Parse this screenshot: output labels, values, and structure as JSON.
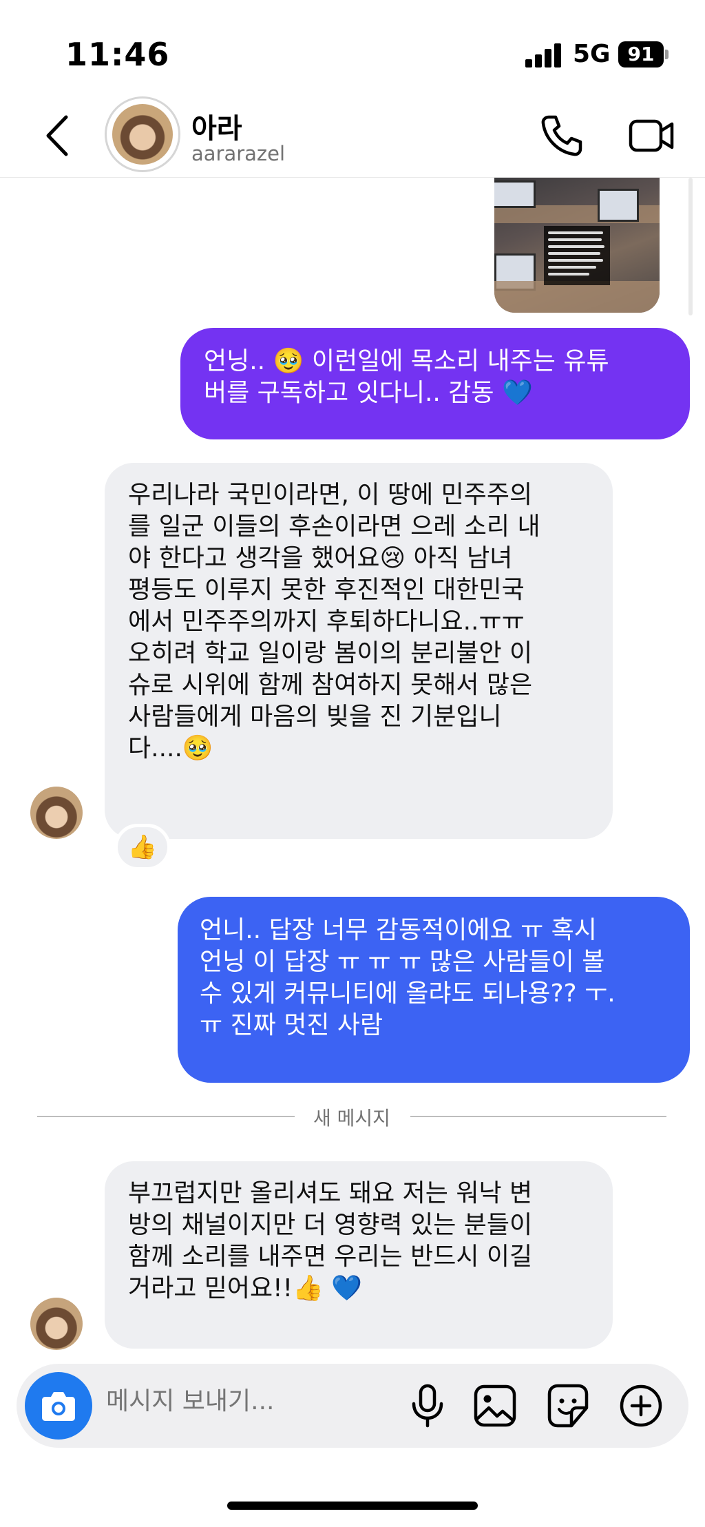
{
  "status_bar": {
    "time": "11:46",
    "network": "5G",
    "battery": "91"
  },
  "header": {
    "contact_name": "아라",
    "contact_handle": "aararazel",
    "icons": [
      "back-chevron-icon",
      "phone-icon",
      "video-camera-icon"
    ]
  },
  "messages": [
    {
      "type": "sent",
      "color": "#7433f2",
      "lines": [
        "언닝.. 🥹 이런일에 목소리 내주는 유튜",
        "버를 구독하고 잇다니.. 감동 💙"
      ]
    },
    {
      "type": "received",
      "lines": [
        "우리나라 국민이라면, 이 땅에 민주주의",
        "를 일군 이들의 후손이라면 으레 소리 내",
        "야 한다고 생각을 했어요😢 아직 남녀",
        "평등도 이루지 못한 후진적인 대한민국",
        "에서 민주주의까지 후퇴하다니요..ㅠㅠ",
        "오히려 학교 일이랑 봄이의 분리불안 이",
        "슈로 시위에 함께 참여하지 못해서 많은",
        "사람들에게 마음의 빚을 진 기분입니",
        "다....🥹"
      ],
      "reaction": "👍"
    },
    {
      "type": "sent",
      "color": "#3c63f3",
      "lines": [
        "언니.. 답장 너무 감동적이에요 ㅠ 혹시",
        "언닝 이 답장 ㅠ ㅠ ㅠ 많은 사람들이 볼",
        "수 있게 커뮤니티에 올랴도 되나용?? ㅜ.",
        "ㅠ 진짜 멋진 사람"
      ]
    },
    {
      "type": "received",
      "lines": [
        "부끄럽지만 올리셔도 돼요 저는 워낙 변",
        "방의 채널이지만 더 영향력 있는 분들이",
        "함께 소리를 내주면 우리는 반드시 이길",
        "거라고 믿어요!!👍 💙"
      ]
    }
  ],
  "divider_label": "새 메시지",
  "composer": {
    "placeholder": "메시지 보내기...",
    "icons": [
      "camera-icon",
      "microphone-icon",
      "image-icon",
      "sticker-icon",
      "plus-icon"
    ]
  },
  "colors": {
    "sent_purple": "#7433f2",
    "sent_blue": "#3c63f3",
    "received_bg": "#eeeff2",
    "camera_blue": "#1f7aef"
  }
}
